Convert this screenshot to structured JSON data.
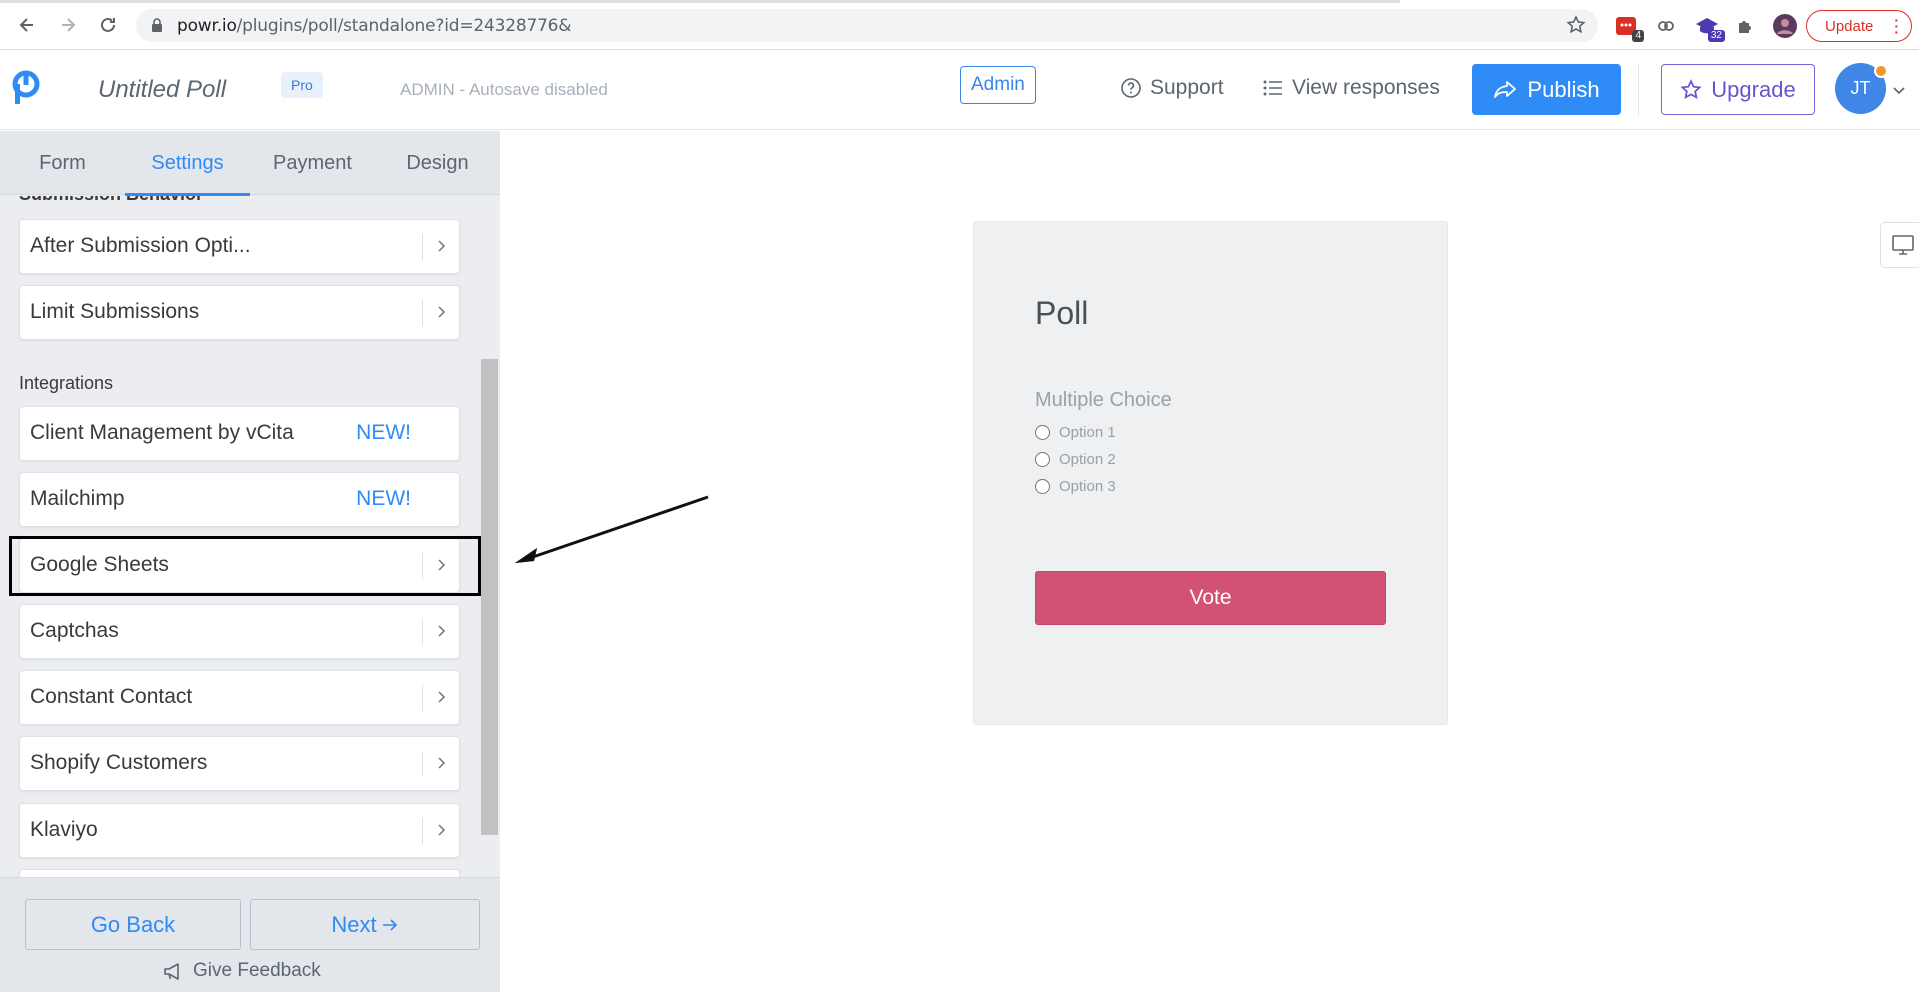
{
  "browser": {
    "url_host": "powr.io",
    "url_path": "/plugins/poll/standalone?id=24328776&",
    "ext_badge_red": "4",
    "ext_badge_purple": "32",
    "update_label": "Update"
  },
  "header": {
    "title": "Untitled Poll",
    "pro_badge": "Pro",
    "autosave": "ADMIN - Autosave disabled",
    "admin_badge": "Admin",
    "support": "Support",
    "view_responses": "View responses",
    "publish": "Publish",
    "upgrade": "Upgrade",
    "avatar_initials": "JT"
  },
  "sidebar": {
    "tabs": [
      {
        "label": "Form"
      },
      {
        "label": "Settings"
      },
      {
        "label": "Payment"
      },
      {
        "label": "Design"
      }
    ],
    "active_tab": "Settings",
    "partial_section": "Submission Behavior",
    "submission_items": [
      {
        "label": "After Submission Opti..."
      },
      {
        "label": "Limit Submissions"
      }
    ],
    "integrations_label": "Integrations",
    "integration_items": [
      {
        "label": "Client Management by vCita",
        "tag": "NEW!"
      },
      {
        "label": "Mailchimp",
        "tag": "NEW!"
      },
      {
        "label": "Google Sheets"
      },
      {
        "label": "Captchas"
      },
      {
        "label": "Constant Contact"
      },
      {
        "label": "Shopify Customers"
      },
      {
        "label": "Klaviyo"
      }
    ],
    "footer": {
      "back": "Go Back",
      "next": "Next",
      "feedback": "Give Feedback"
    }
  },
  "poll": {
    "title": "Poll",
    "question": "Multiple Choice",
    "options": [
      "Option 1",
      "Option 2",
      "Option 3"
    ],
    "vote": "Vote"
  },
  "colors": {
    "primary": "#2f8bf5",
    "vote": "#d15273",
    "upgrade": "#6d52cf",
    "update": "#d93025"
  }
}
